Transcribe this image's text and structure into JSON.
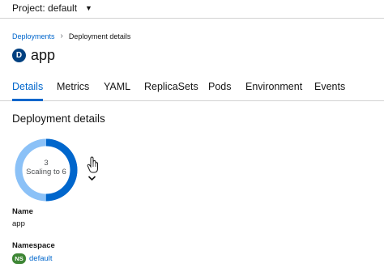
{
  "topbar": {
    "project_label": "Project: default"
  },
  "breadcrumb": {
    "items": [
      "Deployments",
      "Deployment details"
    ]
  },
  "header": {
    "badge": "D",
    "title": "app"
  },
  "tabs": [
    "Details",
    "Metrics",
    "YAML",
    "ReplicaSets",
    "Pods",
    "Environment",
    "Events"
  ],
  "tabs_active": "Details",
  "section": {
    "title": "Deployment details"
  },
  "pod_ring": {
    "count": "3",
    "status": "Scaling to 6",
    "current_pods": 3,
    "desired_pods": 6,
    "colors": {
      "scaling": "#0066cc",
      "pending": "#8bc1f7"
    }
  },
  "details": {
    "name_label": "Name",
    "name_value": "app",
    "namespace_label": "Namespace",
    "namespace_badge": "NS",
    "namespace_value": "default"
  },
  "colors": {
    "link": "#0066cc",
    "ns_badge": "#3e8635",
    "resource_badge": "#004080"
  },
  "icons": [
    "caret-down-icon",
    "chevron-right-icon",
    "hand-cursor-icon",
    "chevron-down-icon"
  ]
}
